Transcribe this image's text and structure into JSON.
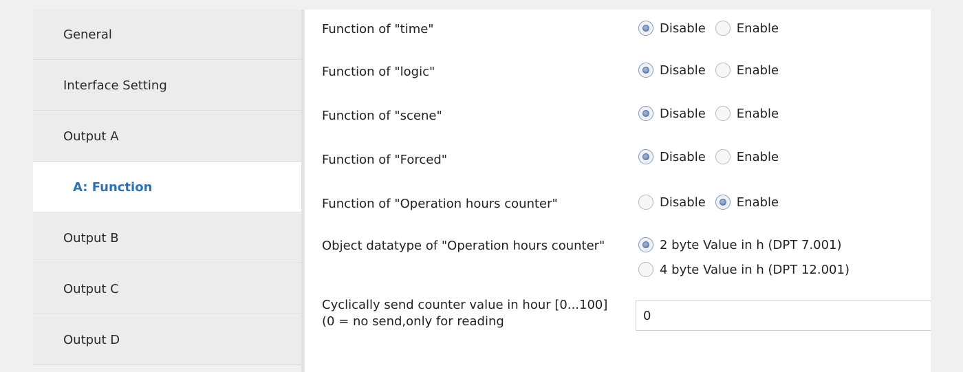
{
  "sidebar": {
    "items": [
      {
        "label": "General"
      },
      {
        "label": "Interface Setting"
      },
      {
        "label": "Output A"
      },
      {
        "label": "A: Function"
      },
      {
        "label": "Output B"
      },
      {
        "label": "Output C"
      },
      {
        "label": "Output D"
      }
    ],
    "active_index": 3
  },
  "params": {
    "time": {
      "label": "Function of \"time\"",
      "options": [
        "Disable",
        "Enable"
      ],
      "selected": "Disable"
    },
    "logic": {
      "label": "Function of \"logic\"",
      "options": [
        "Disable",
        "Enable"
      ],
      "selected": "Disable"
    },
    "scene": {
      "label": "Function of \"scene\"",
      "options": [
        "Disable",
        "Enable"
      ],
      "selected": "Disable"
    },
    "forced": {
      "label": "Function of \"Forced\"",
      "options": [
        "Disable",
        "Enable"
      ],
      "selected": "Disable"
    },
    "hours_counter": {
      "label": "Function of \"Operation hours counter\"",
      "options": [
        "Disable",
        "Enable"
      ],
      "selected": "Enable"
    },
    "datatype": {
      "label": " Object datatype of \"Operation hours counter\"",
      "options": [
        "2 byte Value in h (DPT 7.001)",
        "4 byte Value in h (DPT 12.001)"
      ],
      "selected": "2 byte Value in h (DPT 7.001)"
    },
    "cyclic": {
      "label": " Cyclically send counter value in hour [0...100](0 = no send,only for reading",
      "value": "0"
    }
  },
  "colors": {
    "active_nav_text": "#2f72b0",
    "panel_bg": "#ffffff",
    "sidebar_bg": "#ececec"
  },
  "icons": {
    "radio_checked": "radio-checked-icon",
    "radio_unchecked": "radio-unchecked-icon"
  }
}
